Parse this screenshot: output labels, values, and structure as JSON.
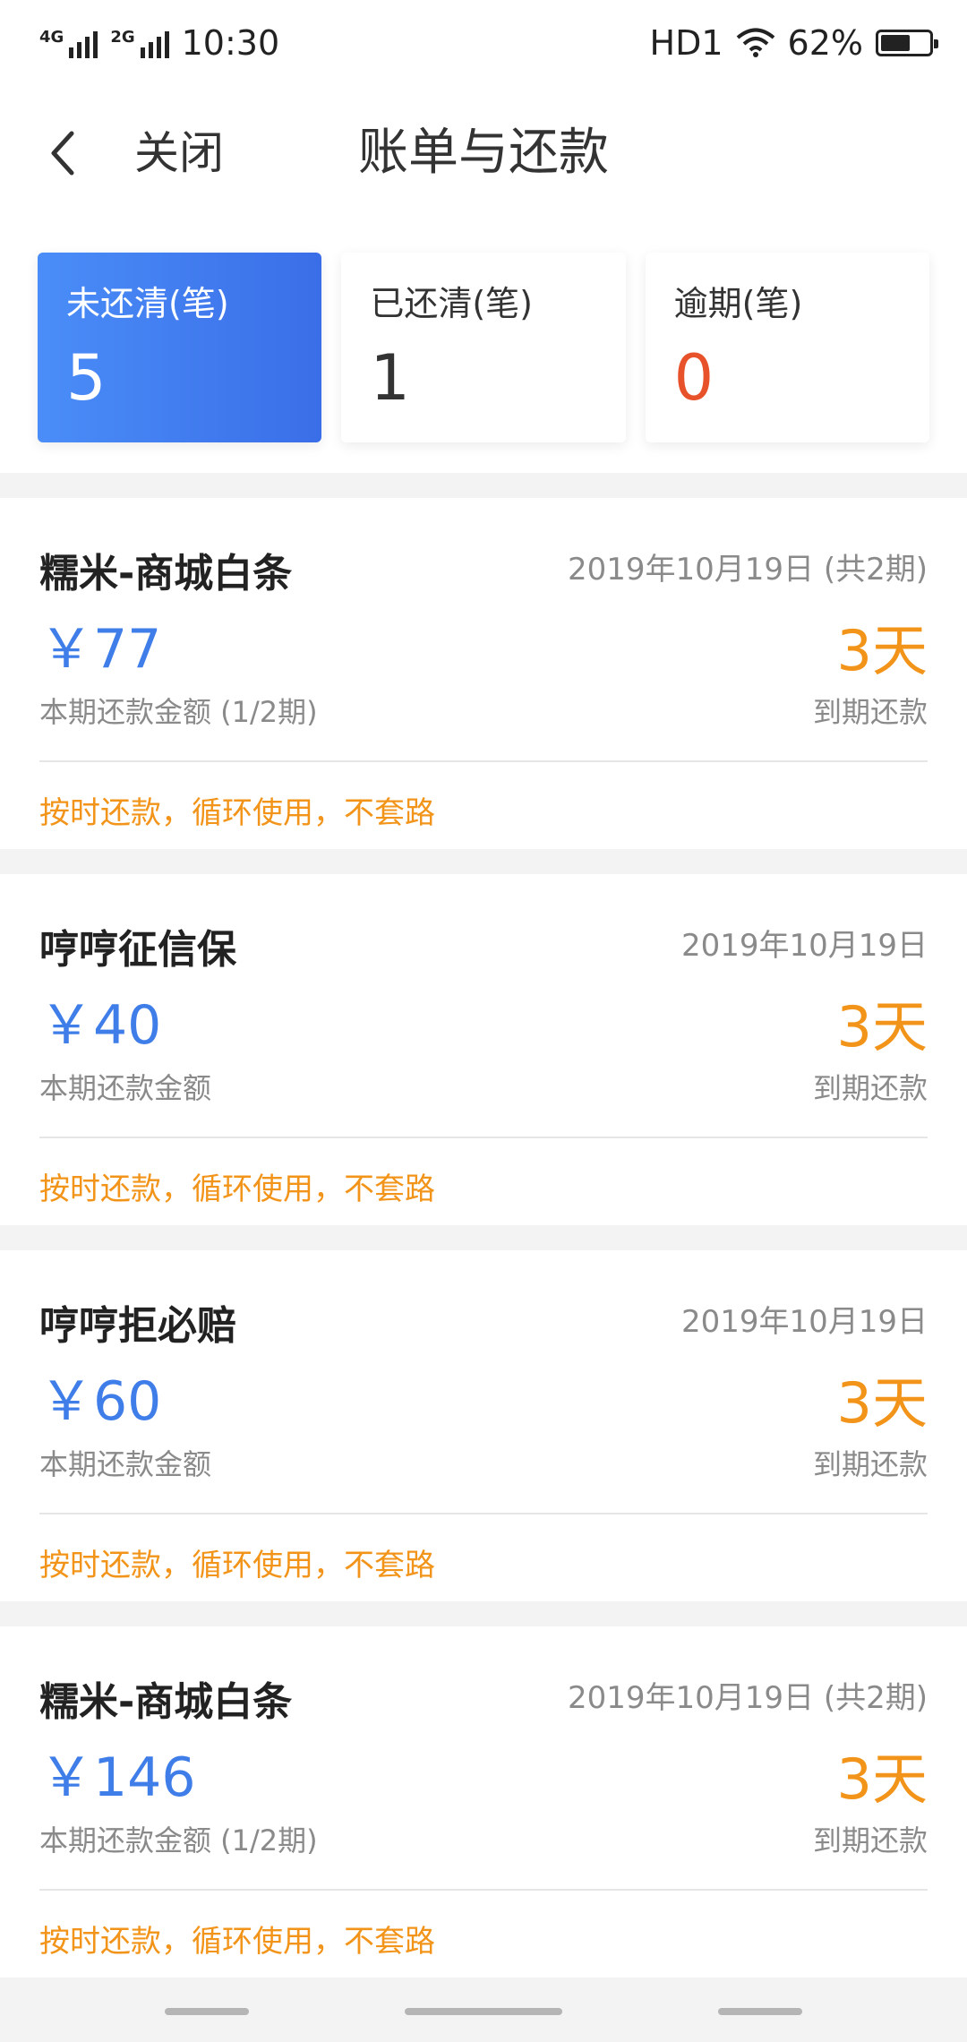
{
  "status_bar": {
    "net1": "4G",
    "net2": "2G",
    "time": "10:30",
    "hd": "HD1",
    "battery_percent": "62%",
    "battery_level": 0.62
  },
  "header": {
    "back_icon": "chevron-left-icon",
    "close_label": "关闭",
    "title": "账单与还款"
  },
  "summary": [
    {
      "label": "未还清(笔)",
      "value": "5",
      "active": true
    },
    {
      "label": "已还清(笔)",
      "value": "1",
      "active": false
    },
    {
      "label": "逾期(笔)",
      "value": "0",
      "active": false
    }
  ],
  "bills": [
    {
      "title": "糯米-商城白条",
      "date": "2019年10月19日 (共2期)",
      "amount": "￥77",
      "days": "3天",
      "amount_label": "本期还款金额 (1/2期)",
      "due_label": "到期还款",
      "slogan": "按时还款，循环使用，不套路"
    },
    {
      "title": "哼哼征信保",
      "date": "2019年10月19日",
      "amount": "￥40",
      "days": "3天",
      "amount_label": "本期还款金额",
      "due_label": "到期还款",
      "slogan": "按时还款，循环使用，不套路"
    },
    {
      "title": "哼哼拒必赔",
      "date": "2019年10月19日",
      "amount": "￥60",
      "days": "3天",
      "amount_label": "本期还款金额",
      "due_label": "到期还款",
      "slogan": "按时还款，循环使用，不套路"
    },
    {
      "title": "糯米-商城白条",
      "date": "2019年10月19日 (共2期)",
      "amount": "￥146",
      "days": "3天",
      "amount_label": "本期还款金额 (1/2期)",
      "due_label": "到期还款",
      "slogan": "按时还款，循环使用，不套路"
    }
  ],
  "colors": {
    "accent_blue": "#3f7de9",
    "orange": "#f29419",
    "red": "#e8522a"
  }
}
